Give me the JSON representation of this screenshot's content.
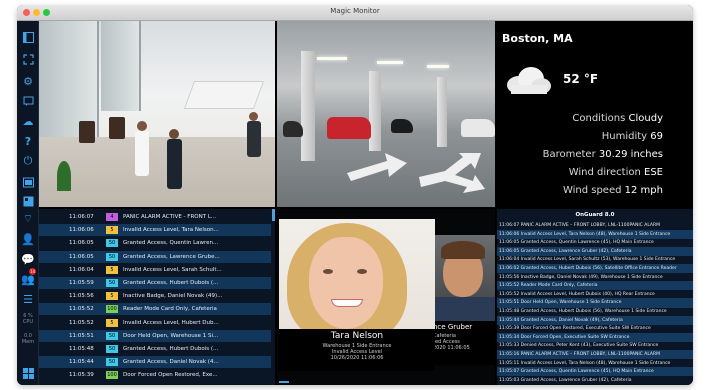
{
  "window": {
    "title": "Magic Monitor"
  },
  "sidebar": {
    "icons": [
      "panel-icon",
      "fullscreen-icon",
      "gear-icon",
      "chat-icon",
      "cloud-icon",
      "help-icon",
      "power-icon",
      "video-icon",
      "map-icon",
      "wifi-icon",
      "user-icon",
      "message-icon",
      "users-icon",
      "list-icon",
      "windows-icon"
    ],
    "badge": "14",
    "cpu": {
      "value": "6 %",
      "label": "CPU"
    },
    "mem": {
      "value": "0.0",
      "label": "Mem"
    }
  },
  "weather": {
    "city": "Boston, MA",
    "temperature": "52 °F",
    "rows": [
      {
        "label": "Conditions",
        "value": "Cloudy"
      },
      {
        "label": "Humidity",
        "value": "69"
      },
      {
        "label": "Barometer",
        "value": "30.29 inches"
      },
      {
        "label": "Wind direction",
        "value": "ESE"
      },
      {
        "label": "Wind speed",
        "value": "12 mph"
      }
    ]
  },
  "event_log": [
    {
      "time": "11:06:07",
      "badge": "4",
      "badge_color": "#c060e0",
      "message": "PANIC ALARM ACTIVE - FRONT L..."
    },
    {
      "time": "11:06:06",
      "badge": "5",
      "badge_color": "#f0c040",
      "message": "Invalid Access Level, Tara Nelson..."
    },
    {
      "time": "11:06:05",
      "badge": "50",
      "badge_color": "#40c8e8",
      "message": "Granted Access, Quentin Lawren..."
    },
    {
      "time": "11:06:05",
      "badge": "50",
      "badge_color": "#40c8e8",
      "message": "Granted Access, Lawrence Grube..."
    },
    {
      "time": "11:06:04",
      "badge": "5",
      "badge_color": "#f0c040",
      "message": "Invalid Access Level, Sarah Schult..."
    },
    {
      "time": "11:05:59",
      "badge": "50",
      "badge_color": "#40c8e8",
      "message": "Granted Access, Hubert Dubois (..."
    },
    {
      "time": "11:05:56",
      "badge": "5",
      "badge_color": "#f0c040",
      "message": "Inactive Badge, Daniel Novak (49)..."
    },
    {
      "time": "11:05:52",
      "badge": "100",
      "badge_color": "#7ad05a",
      "message": "Reader Mode Card Only, Cafeteria"
    },
    {
      "time": "11:05:52",
      "badge": "5",
      "badge_color": "#f0c040",
      "message": "Invalid Access Level, Hubert Dub..."
    },
    {
      "time": "11:05:51",
      "badge": "50",
      "badge_color": "#40c8e8",
      "message": "Door Held Open, Warehouse 1 Si..."
    },
    {
      "time": "11:05:48",
      "badge": "50",
      "badge_color": "#40c8e8",
      "message": "Granted Access, Hubert Dubois (..."
    },
    {
      "time": "11:05:44",
      "badge": "50",
      "badge_color": "#40c8e8",
      "message": "Granted Access, Daniel Novak (4..."
    },
    {
      "time": "11:05:39",
      "badge": "100",
      "badge_color": "#7ad05a",
      "message": "Door Forced Open Restored, Exe..."
    }
  ],
  "photo": {
    "primary": {
      "name": "Tara Nelson",
      "line1": "Warehouse 1 Side Entrance",
      "line2": "Invalid Access Level",
      "line3": "10/26/2020 11:06:06"
    },
    "secondary": {
      "name": "nce Gruber",
      "line1": "Cafeteria",
      "line2": "ted Access",
      "line3": "2020 11:06:05"
    }
  },
  "onguard": {
    "title": "OnGuard 8.0",
    "rows": [
      {
        "text": "11:06:07  PANIC ALARM ACTIVE – FRONT LOBBY, LNL-1100PANIC ALARM",
        "location": ""
      },
      {
        "text": "11:06:06  Invalid Access Level, Tara Nelson (48), Warehouse 1 Side Entrance",
        "location": ""
      },
      {
        "text": "11:06:05  Granted Access, Quentin Lawrence (45), HQ Main Entrance",
        "location": ""
      },
      {
        "text": "11:06:05  Granted Access, Lawrence Gruber (42), Cafeteria",
        "location": ""
      },
      {
        "text": "11:06:04  Invalid Access Level, Sarah Schultz (53), Warehouse 1 Side Entrance",
        "location": ""
      },
      {
        "text": "11:06:02  Granted Access, Hubert Dubois (56), Satellite Office Entrance Reader",
        "location": ""
      },
      {
        "text": "11:05:56  Inactive Badge, Daniel Novak (49), Warehouse 1 Side Entrance",
        "location": ""
      },
      {
        "text": "11:05:52  Reader Mode Card Only, Cafeteria",
        "location": ""
      },
      {
        "text": "11:05:52  Invalid Access Level, Hubert Dubois (40), HQ Rear Entrance",
        "location": ""
      },
      {
        "text": "11:05:51  Door Held Open, Warehouse 1 Side Entrance",
        "location": ""
      },
      {
        "text": "11:05:48  Granted Access, Hubert Dubois (56), Warehouse 1 Side Entrance",
        "location": ""
      },
      {
        "text": "11:05:44  Granted Access, Daniel Novak (49), Cafeteria",
        "location": ""
      },
      {
        "text": "11:05:39  Door Forced Open Restored, Executive Suite SW Entrance",
        "location": ""
      },
      {
        "text": "11:05:34  Door Forced Open, Executive Suite SW Entrance",
        "location": ""
      },
      {
        "text": "11:05:33  Denied Access, Peter Kent (43), Executive Suite SW Entrance",
        "location": ""
      },
      {
        "text": "11:05:16  PANIC ALARM ACTIVE – FRONT LOBBY, LNL-1100PANIC ALARM",
        "location": ""
      },
      {
        "text": "11:05:11  Invalid Access Level, Tara Nelson (48), Warehouse 1 Side Entrance",
        "location": ""
      },
      {
        "text": "11:05:07  Granted Access, Quentin Lawrence (45), HQ Main Entrance",
        "location": ""
      },
      {
        "text": "11:05:03  Granted Access, Lawrence Gruber (42), Cafeteria",
        "location": ""
      }
    ]
  }
}
